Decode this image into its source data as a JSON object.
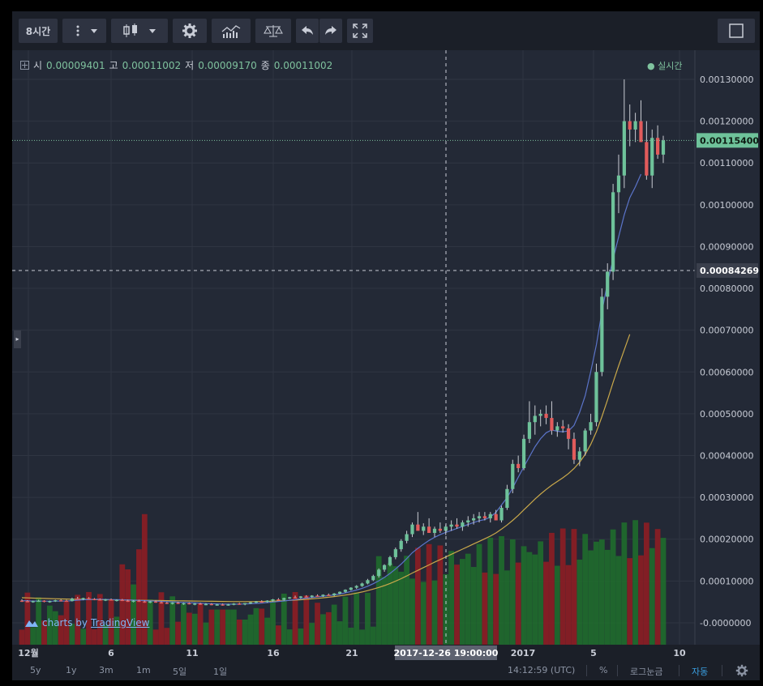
{
  "toolbar": {
    "interval": "8시간",
    "tools": [
      "more-vertical-icon",
      "dropdown-icon",
      "candlestick-icon",
      "dropdown-icon",
      "gear-icon",
      "indicators-icon",
      "compare-icon",
      "undo-icon",
      "redo-icon",
      "fullscreen-icon"
    ],
    "layout_icon": "square-icon"
  },
  "legend": {
    "open_label": "시",
    "open": "0.00009401",
    "high_label": "고",
    "high": "0.00011002",
    "low_label": "저",
    "low": "0.00009170",
    "close_label": "종",
    "close": "0.00011002",
    "live": "● 실시간"
  },
  "branding": {
    "prefix": "charts by",
    "brand": "TradingView"
  },
  "bottom": {
    "ranges": [
      "5y",
      "1y",
      "3m",
      "1m",
      "5일",
      "1일"
    ],
    "time": "14:12:59 (UTC)",
    "percent": "%",
    "log": "로그눈금",
    "auto": "자동"
  },
  "colors": {
    "up": "#6ec29a",
    "down": "#e25b5b",
    "ma_short": "#5b74c9",
    "ma_long": "#c9a84a",
    "vol_up": "#1f6b2c",
    "vol_down": "#8d1d23"
  },
  "chart_data": {
    "type": "candlestick",
    "y_axis": {
      "min": -1e-07,
      "max": 0.0013,
      "ticks": [
        "0.00130000",
        "0.00120000",
        "0.00110000",
        "0.00100000",
        "0.00090000",
        "0.00080000",
        "0.00070000",
        "0.00060000",
        "0.00050000",
        "0.00040000",
        "0.00030000",
        "0.00020000",
        "0.00010000",
        "-0.0000000"
      ]
    },
    "x_axis": {
      "labels": [
        "12월",
        "6",
        "11",
        "16",
        "21",
        "2017",
        "5",
        "10"
      ]
    },
    "last_price": "0.00115400",
    "crosshair_price": "0.00084269",
    "crosshair_time": "2017-12-26 19:00:00",
    "candles": [
      [
        5.3e-05,
        5.6e-05,
        5e-05,
        5.2e-05
      ],
      [
        5.2e-05,
        5.4e-05,
        4.9e-05,
        5.1e-05
      ],
      [
        5.1e-05,
        5.3e-05,
        4.8e-05,
        5.2e-05
      ],
      [
        5.2e-05,
        5.5e-05,
        5e-05,
        5.3e-05
      ],
      [
        5.3e-05,
        5.4e-05,
        4.9e-05,
        5e-05
      ],
      [
        5e-05,
        5.3e-05,
        4.8e-05,
        5.2e-05
      ],
      [
        5.2e-05,
        5.5e-05,
        5e-05,
        5.4e-05
      ],
      [
        5.4e-05,
        5.6e-05,
        5.1e-05,
        5.3e-05
      ],
      [
        5.3e-05,
        5.5e-05,
        5e-05,
        5.2e-05
      ],
      [
        5.2e-05,
        6e-05,
        5.1e-05,
        5.8e-05
      ],
      [
        5.8e-05,
        6.2e-05,
        5.5e-05,
        5.7e-05
      ],
      [
        5.7e-05,
        6e-05,
        5.4e-05,
        5.9e-05
      ],
      [
        5.9e-05,
        6.1e-05,
        5.6e-05,
        5.7e-05
      ],
      [
        5.7e-05,
        5.9e-05,
        5.4e-05,
        5.6e-05
      ],
      [
        5.6e-05,
        5.8e-05,
        5.3e-05,
        5.5e-05
      ],
      [
        5.5e-05,
        5.7e-05,
        5.2e-05,
        5.6e-05
      ],
      [
        5.6e-05,
        5.8e-05,
        5.3e-05,
        5.4e-05
      ],
      [
        5.4e-05,
        5.6e-05,
        5.1e-05,
        5.5e-05
      ],
      [
        5.5e-05,
        5.7e-05,
        5.2e-05,
        5.3e-05
      ],
      [
        5.3e-05,
        5.5e-05,
        5e-05,
        5.2e-05
      ],
      [
        5.2e-05,
        5.4e-05,
        4.9e-05,
        5.3e-05
      ],
      [
        5.3e-05,
        5.5e-05,
        5e-05,
        5.1e-05
      ],
      [
        5.1e-05,
        5.3e-05,
        4.8e-05,
        5e-05
      ],
      [
        5e-05,
        5.2e-05,
        4.7e-05,
        5.1e-05
      ],
      [
        5.1e-05,
        5.3e-05,
        4.8e-05,
        4.9e-05
      ],
      [
        4.9e-05,
        5.1e-05,
        4.6e-05,
        4.8e-05
      ],
      [
        4.8e-05,
        5e-05,
        4.5e-05,
        4.7e-05
      ],
      [
        4.7e-05,
        4.9e-05,
        4.4e-05,
        4.8e-05
      ],
      [
        4.8e-05,
        5e-05,
        4.5e-05,
        4.6e-05
      ],
      [
        4.6e-05,
        4.8e-05,
        4.3e-05,
        4.7e-05
      ],
      [
        4.7e-05,
        4.9e-05,
        4.4e-05,
        4.5e-05
      ],
      [
        4.5e-05,
        4.7e-05,
        4.2e-05,
        4.6e-05
      ],
      [
        4.6e-05,
        4.8e-05,
        4.3e-05,
        4.4e-05
      ],
      [
        4.4e-05,
        4.7e-05,
        4.2e-05,
        4.5e-05
      ],
      [
        4.5e-05,
        4.7e-05,
        4.2e-05,
        4.3e-05
      ],
      [
        4.3e-05,
        4.5e-05,
        4.1e-05,
        4.4e-05
      ],
      [
        4.4e-05,
        4.6e-05,
        4.1e-05,
        4.3e-05
      ],
      [
        4.3e-05,
        4.5e-05,
        4.1e-05,
        4.4e-05
      ],
      [
        4.4e-05,
        4.7e-05,
        4.2e-05,
        4.6e-05
      ],
      [
        4.6e-05,
        4.8e-05,
        4.3e-05,
        4.5e-05
      ],
      [
        4.5e-05,
        4.7e-05,
        4.2e-05,
        4.7e-05
      ],
      [
        4.7e-05,
        5e-05,
        4.5e-05,
        4.9e-05
      ],
      [
        4.9e-05,
        5.2e-05,
        4.7e-05,
        5.1e-05
      ],
      [
        5.1e-05,
        5.4e-05,
        4.9e-05,
        5e-05
      ],
      [
        5e-05,
        5.4e-05,
        4.8e-05,
        5.3e-05
      ],
      [
        5.3e-05,
        5.7e-05,
        5.1e-05,
        5.6e-05
      ],
      [
        5.6e-05,
        5.9e-05,
        5.4e-05,
        5.5e-05
      ],
      [
        5.5e-05,
        6e-05,
        5.3e-05,
        5.9e-05
      ],
      [
        5.9e-05,
        6.2e-05,
        5.7e-05,
        6.1e-05
      ],
      [
        6.1e-05,
        6.5e-05,
        5.9e-05,
        6e-05
      ],
      [
        6e-05,
        6.4e-05,
        5.8e-05,
        6.3e-05
      ],
      [
        6.3e-05,
        6.6e-05,
        6.1e-05,
        6.2e-05
      ],
      [
        6.2e-05,
        6.6e-05,
        6e-05,
        6.5e-05
      ],
      [
        6.5e-05,
        6.8e-05,
        6.3e-05,
        6.4e-05
      ],
      [
        6.4e-05,
        6.8e-05,
        6.2e-05,
        6.7e-05
      ],
      [
        6.7e-05,
        7e-05,
        6.5e-05,
        6.6e-05
      ],
      [
        6.6e-05,
        7.1e-05,
        6.4e-05,
        7e-05
      ],
      [
        7e-05,
        7.5e-05,
        6.8e-05,
        7.4e-05
      ],
      [
        7.4e-05,
        8e-05,
        7.2e-05,
        7.9e-05
      ],
      [
        7.9e-05,
        8.5e-05,
        7.7e-05,
        8.4e-05
      ],
      [
        8.4e-05,
        9e-05,
        8.1e-05,
        8.8e-05
      ],
      [
        8.8e-05,
        9.6e-05,
        8.6e-05,
        9.4e-05
      ],
      [
        9.4e-05,
        0.000105,
        9.2e-05,
        0.000102
      ],
      [
        0.000102,
        0.000115,
        0.0001,
        0.000112
      ],
      [
        0.000112,
        0.00013,
        0.000108,
        0.000127
      ],
      [
        0.000127,
        0.00014,
        0.000122,
        0.000138
      ],
      [
        0.000138,
        0.00016,
        0.000135,
        0.000157
      ],
      [
        0.000157,
        0.00018,
        0.000152,
        0.000176
      ],
      [
        0.000176,
        0.0002,
        0.00017,
        0.000196
      ],
      [
        0.000196,
        0.00022,
        0.00019,
        0.000212
      ],
      [
        0.000212,
        0.00024,
        0.000205,
        0.000235
      ],
      [
        0.000235,
        0.000265,
        0.000225,
        0.00022
      ],
      [
        0.00022,
        0.000238,
        0.00021,
        0.00023
      ],
      [
        0.00023,
        0.00025,
        0.000215,
        0.000215
      ],
      [
        0.000215,
        0.00023,
        0.000205,
        0.000225
      ],
      [
        0.000225,
        0.00024,
        0.000215,
        0.00022
      ],
      [
        0.00022,
        0.000235,
        0.00021,
        0.00023
      ],
      [
        0.00023,
        0.000245,
        0.00022,
        0.000235
      ],
      [
        0.000235,
        0.00025,
        0.000225,
        0.00023
      ],
      [
        0.00023,
        0.000245,
        0.00022,
        0.00024
      ],
      [
        0.00024,
        0.000255,
        0.00023,
        0.000245
      ],
      [
        0.000245,
        0.00026,
        0.000235,
        0.00025
      ],
      [
        0.00025,
        0.000265,
        0.00024,
        0.000255
      ],
      [
        0.000255,
        0.000265,
        0.000245,
        0.00025
      ],
      [
        0.00025,
        0.000265,
        0.00024,
        0.00026
      ],
      [
        0.00026,
        0.00027,
        0.000245,
        0.000245
      ],
      [
        0.000245,
        0.00028,
        0.00024,
        0.000275
      ],
      [
        0.000275,
        0.00033,
        0.00027,
        0.00032
      ],
      [
        0.00032,
        0.00039,
        0.00031,
        0.00038
      ],
      [
        0.00038,
        0.0004,
        0.00036,
        0.00037
      ],
      [
        0.00037,
        0.00045,
        0.000365,
        0.00044
      ],
      [
        0.00044,
        0.00053,
        0.00043,
        0.00048
      ],
      [
        0.00048,
        0.00052,
        0.00045,
        0.000495
      ],
      [
        0.000495,
        0.00051,
        0.00047,
        0.0005
      ],
      [
        0.0005,
        0.00052,
        0.000475,
        0.00049
      ],
      [
        0.00049,
        0.00053,
        0.00045,
        0.00046
      ],
      [
        0.00046,
        0.00048,
        0.000445,
        0.00047
      ],
      [
        0.00047,
        0.000485,
        0.000455,
        0.000465
      ],
      [
        0.000465,
        0.000475,
        0.000415,
        0.00044
      ],
      [
        0.00044,
        0.000455,
        0.00038,
        0.00039
      ],
      [
        0.00039,
        0.00042,
        0.000375,
        0.00041
      ],
      [
        0.00041,
        0.000465,
        0.0004,
        0.00046
      ],
      [
        0.00046,
        0.0005,
        0.00045,
        0.00048
      ],
      [
        0.00048,
        0.00062,
        0.00047,
        0.0006
      ],
      [
        0.0006,
        0.0008,
        0.00059,
        0.00078
      ],
      [
        0.00078,
        0.00086,
        0.00075,
        0.00084
      ],
      [
        0.00084,
        0.00105,
        0.00082,
        0.00103
      ],
      [
        0.00103,
        0.00112,
        0.00098,
        0.00107
      ],
      [
        0.00107,
        0.0013,
        0.00104,
        0.0012
      ],
      [
        0.0012,
        0.00124,
        0.00114,
        0.00118
      ],
      [
        0.00118,
        0.00122,
        0.00115,
        0.0012
      ],
      [
        0.0012,
        0.00125,
        0.00115,
        0.00115
      ],
      [
        0.00115,
        0.0012,
        0.00106,
        0.00107
      ],
      [
        0.00107,
        0.00118,
        0.00104,
        0.00116
      ],
      [
        0.00116,
        0.00119,
        0.00111,
        0.00112
      ],
      [
        0.00112,
        0.001165,
        0.0011,
        0.001154
      ]
    ],
    "volume": [
      0.0,
      1e-05,
      1e-05,
      2e-05,
      1e-05,
      1e-05,
      1e-05,
      2e-05,
      2e-05,
      1e-05,
      1e-05,
      1e-05,
      1e-05,
      1e-05,
      2e-05,
      2e-05,
      2e-05,
      2e-05,
      0.00016,
      0.00015,
      0.00012,
      0.00019,
      0.00026,
      9e-05,
      1e-05,
      1e-05,
      1e-05,
      1e-05,
      1e-05,
      1e-05,
      1e-05,
      1e-05,
      1e-05,
      1e-05,
      7e-05,
      7e-05,
      7e-05,
      7e-05,
      7e-05,
      5e-05,
      5e-05,
      6e-05,
      1e-05,
      1e-05,
      1e-05,
      1e-05,
      1e-05,
      1e-05,
      1e-05,
      1e-05,
      1e-05,
      1e-05,
      1e-05,
      1e-05,
      1e-05,
      1e-05,
      1e-05,
      1e-05,
      1e-05,
      1e-05,
      1e-05,
      1e-05,
      1e-05,
      1e-05,
      1e-05,
      1e-05,
      1e-05,
      1e-05,
      1e-05,
      1e-05,
      1e-05,
      1e-05,
      1e-05,
      1e-05,
      1e-05,
      1e-05,
      1e-05,
      1e-05,
      1e-05,
      1e-05,
      1e-05,
      1e-05,
      1e-05,
      1e-05,
      1e-05,
      1e-05,
      1e-05,
      1e-05,
      1e-05,
      1e-05,
      1e-05,
      1e-05,
      1e-05,
      1e-05,
      1e-05,
      1e-05,
      1e-05,
      1e-05,
      1e-05,
      1e-05,
      1e-05,
      1e-05,
      1e-05,
      1e-05,
      1e-05,
      1e-05,
      1e-05,
      1e-05,
      1e-05
    ],
    "ma_short": [
      5.3e-05,
      5.25e-05,
      5.2e-05,
      5.21e-05,
      5.18e-05,
      5.16e-05,
      5.19e-05,
      5.21e-05,
      5.21e-05,
      5.3e-05,
      5.41e-05,
      5.51e-05,
      5.58e-05,
      5.61e-05,
      5.6e-05,
      5.59e-05,
      5.56e-05,
      5.53e-05,
      5.49e-05,
      5.45e-05,
      5.41e-05,
      5.36e-05,
      5.3e-05,
      5.25e-05,
      5.19e-05,
      5.13e-05,
      5.06e-05,
      5e-05,
      4.94e-05,
      4.88e-05,
      4.81e-05,
      4.75e-05,
      4.69e-05,
      4.63e-05,
      4.58e-05,
      4.53e-05,
      4.49e-05,
      4.46e-05,
      4.45e-05,
      4.46e-05,
      4.5e-05,
      4.56e-05,
      4.64e-05,
      4.72e-05,
      4.83e-05,
      4.96e-05,
      5.08e-05,
      5.23e-05,
      5.4e-05,
      5.56e-05,
      5.74e-05,
      5.9e-05,
      6.06e-05,
      6.21e-05,
      6.35e-05,
      6.5e-05,
      6.66e-05,
      6.89e-05,
      7.16e-05,
      7.48e-05,
      7.83e-05,
      8.25e-05,
      8.75e-05,
      9.35e-05,
      0.0001005,
      0.0001086,
      0.000118,
      0.0001286,
      0.0001404,
      0.0001535,
      0.0001676,
      0.0001781,
      0.0001878,
      0.000197,
      0.0002046,
      0.0002109,
      0.0002163,
      0.0002209,
      0.0002258,
      0.0002305,
      0.0002352,
      0.0002397,
      0.0002442,
      0.000247,
      0.0002529,
      0.0002646,
      0.0002818,
      0.0002995,
      0.0003227,
      0.0003484,
      0.0003728,
      0.0003971,
      0.0004212,
      0.0004405,
      0.0004547,
      0.0004613,
      0.0004582,
      0.000457,
      0.0004589,
      0.000472,
      0.000503,
      0.0005431,
      0.0006014,
      0.000665,
      0.0007435,
      0.0008135,
      0.00087,
      0.0009235,
      0.000976,
      0.001017,
      0.001043,
      0.0010734
    ],
    "ma_long": [
      6e-05,
      5.95e-05,
      5.9e-05,
      5.86e-05,
      5.82e-05,
      5.78e-05,
      5.74e-05,
      5.71e-05,
      5.68e-05,
      5.65e-05,
      5.62e-05,
      5.6e-05,
      5.58e-05,
      5.56e-05,
      5.54e-05,
      5.52e-05,
      5.5e-05,
      5.48e-05,
      5.46e-05,
      5.44e-05,
      5.42e-05,
      5.4e-05,
      5.38e-05,
      5.36e-05,
      5.34e-05,
      5.32e-05,
      5.3e-05,
      5.28e-05,
      5.26e-05,
      5.24e-05,
      5.22e-05,
      5.2e-05,
      5.18e-05,
      5.16e-05,
      5.14e-05,
      5.12e-05,
      5.1e-05,
      5.08e-05,
      5.07e-05,
      5.06e-05,
      5.06e-05,
      5.07e-05,
      5.08e-05,
      5.1e-05,
      5.13e-05,
      5.17e-05,
      5.22e-05,
      5.28e-05,
      5.35e-05,
      5.43e-05,
      5.52e-05,
      5.62e-05,
      5.73e-05,
      5.85e-05,
      5.98e-05,
      6.12e-05,
      6.27e-05,
      6.44e-05,
      6.63e-05,
      6.85e-05,
      7.1e-05,
      7.38e-05,
      7.7e-05,
      8.06e-05,
      8.46e-05,
      8.9e-05,
      9.4e-05,
      9.95e-05,
      0.0001055,
      0.000112,
      0.000119,
      0.0001255,
      0.000132,
      0.0001385,
      0.000145,
      0.0001512,
      0.0001575,
      0.0001638,
      0.00017,
      0.0001762,
      0.0001824,
      0.0001886,
      0.0001948,
      0.000201,
      0.0002075,
      0.000215,
      0.000224,
      0.000234,
      0.000245,
      0.000257,
      0.00027,
      0.000283,
      0.000296,
      0.000308,
      0.000319,
      0.000329,
      0.000338,
      0.000347,
      0.000357,
      0.000369,
      0.000384,
      0.000403,
      0.000427,
      0.000457,
      0.000493,
      0.000533,
      0.000575,
      0.000615,
      0.000653,
      0.00069
    ]
  }
}
